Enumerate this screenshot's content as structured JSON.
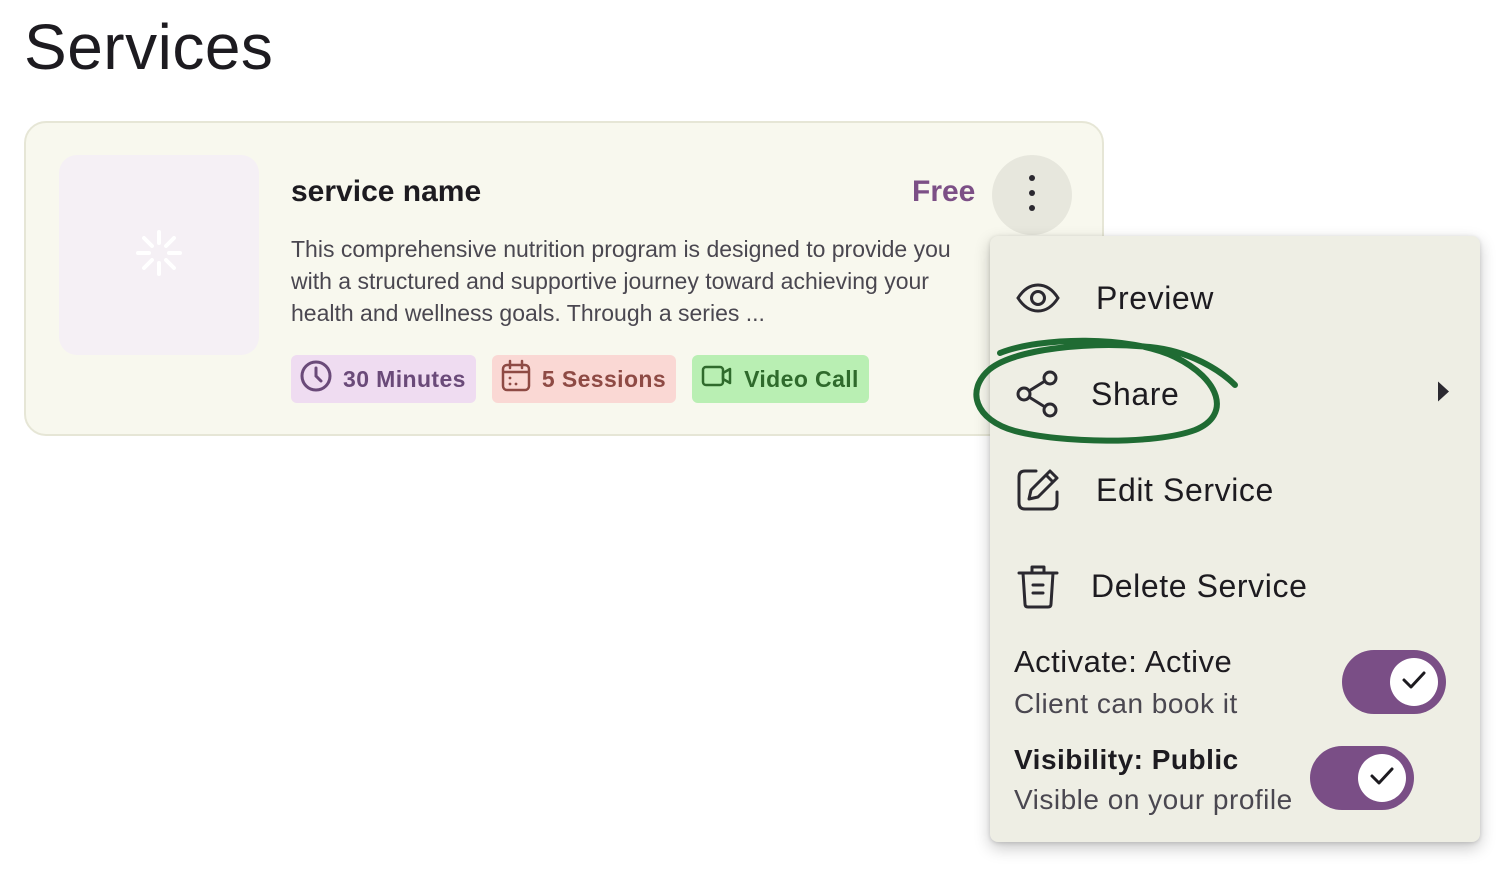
{
  "page": {
    "title": "Services"
  },
  "service_card": {
    "name": "service name",
    "price": "Free",
    "description_lines": [
      "This comprehensive nutrition program is designed to provide you",
      "with a structured and supportive journey toward achieving your",
      "health and wellness goals. Through a series ..."
    ],
    "tags": [
      {
        "icon": "clock-icon",
        "label": "30 Minutes"
      },
      {
        "icon": "calendar-icon",
        "label": "5 Sessions"
      },
      {
        "icon": "video-camera-icon",
        "label": "Video Call"
      }
    ],
    "thumbnail_icon": "loading-spinner-icon",
    "more_icon": "more-vertical-icon"
  },
  "menu": {
    "items": [
      {
        "icon": "eye-icon",
        "label": "Preview"
      },
      {
        "icon": "share-icon",
        "label": "Share",
        "submenu_icon": "chevron-right-icon"
      },
      {
        "icon": "edit-icon",
        "label": "Edit Service"
      },
      {
        "icon": "trash-icon",
        "label": "Delete Service"
      }
    ],
    "toggles": [
      {
        "title": "Activate: Active",
        "subtitle": "Client can book it",
        "on": true
      },
      {
        "title": "Visibility: Public",
        "subtitle": "Visible on your profile",
        "on": true
      }
    ]
  },
  "colors": {
    "accent": "#7a4e86",
    "card_bg": "#f8f8ee",
    "menu_bg": "#eeeee4",
    "annotation": "#1f6b33",
    "tag_duration_bg": "#efdcf1",
    "tag_sessions_bg": "#fad8d4",
    "tag_video_bg": "#b9efb3"
  }
}
